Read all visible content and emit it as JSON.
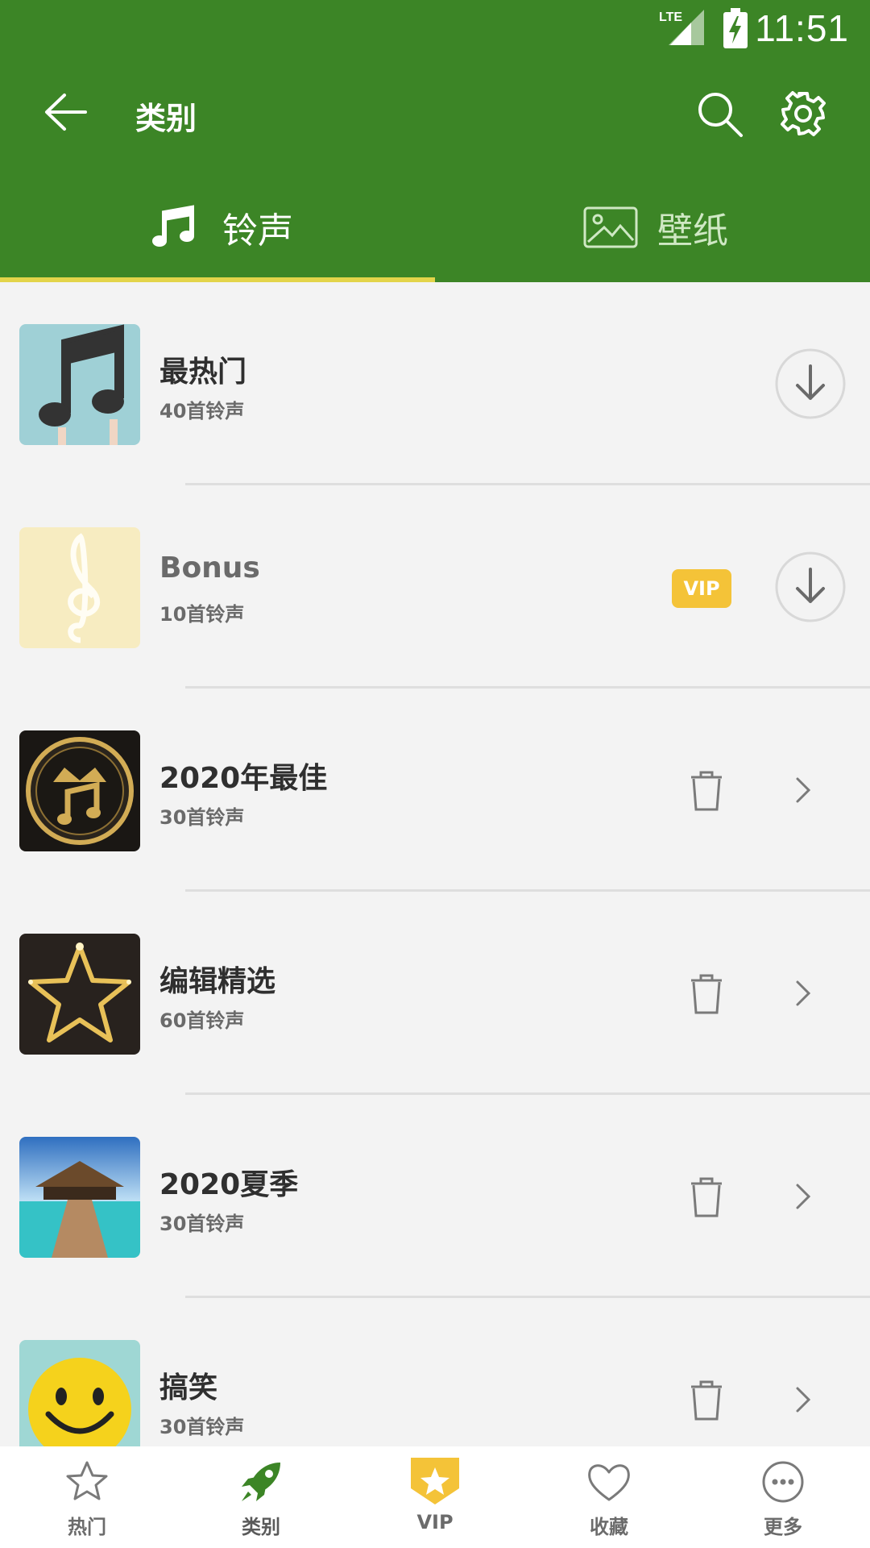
{
  "status_bar": {
    "network": "LTE",
    "time": "11:51"
  },
  "toolbar": {
    "title": "类别"
  },
  "tabs": [
    {
      "label": "铃声",
      "selected": true
    },
    {
      "label": "壁纸",
      "selected": false
    }
  ],
  "categories": [
    {
      "title": "最热门",
      "count": "40首铃声",
      "action": "download"
    },
    {
      "title": "Bonus",
      "count": "10首铃声",
      "badge": "VIP",
      "action": "download"
    },
    {
      "title": "2020年最佳",
      "count": "30首铃声",
      "action": "delete-open"
    },
    {
      "title": "编辑精选",
      "count": "60首铃声",
      "action": "delete-open"
    },
    {
      "title": "2020夏季",
      "count": "30首铃声",
      "action": "delete-open"
    },
    {
      "title": "搞笑",
      "count": "30首铃声",
      "action": "delete-open"
    }
  ],
  "bottom_nav": [
    {
      "label": "热门",
      "icon": "star-icon"
    },
    {
      "label": "类别",
      "icon": "rocket-icon",
      "active": true
    },
    {
      "label": "VIP",
      "icon": "vip-shield-icon"
    },
    {
      "label": "收藏",
      "icon": "heart-icon"
    },
    {
      "label": "更多",
      "icon": "more-icon"
    }
  ],
  "colors": {
    "primary": "#3c8526",
    "tab_indicator": "#e3d44a",
    "vip": "#f4c338",
    "background": "#f3f3f3"
  }
}
